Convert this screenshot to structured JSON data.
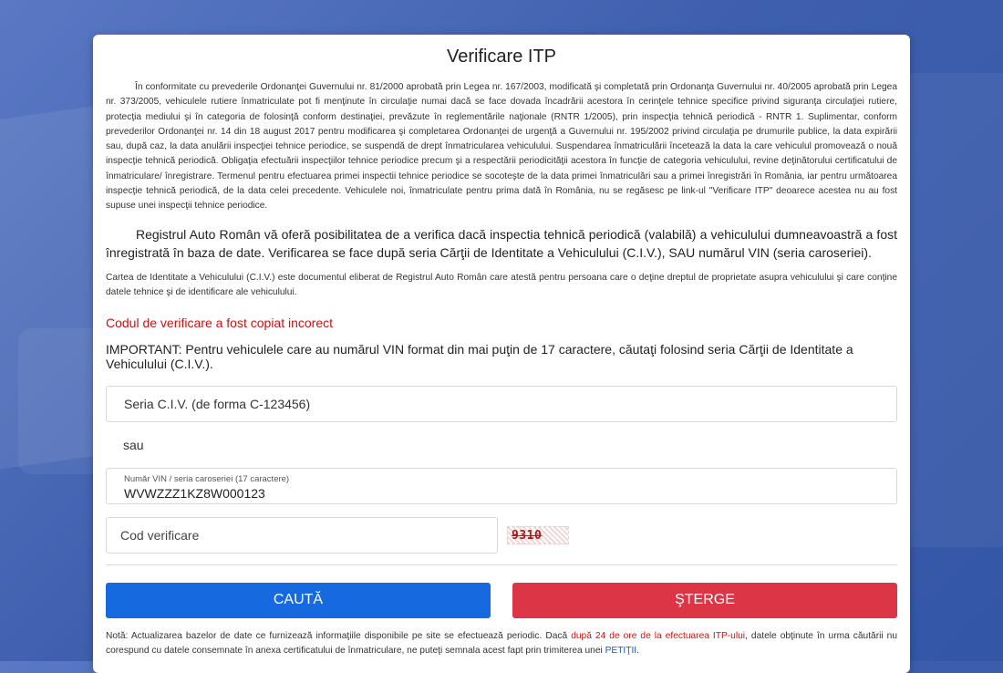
{
  "page": {
    "title": "Verificare ITP"
  },
  "intro": {
    "text": "În conformitate cu prevederile Ordonanţei Guvernului nr. 81/2000 aprobată prin Legea nr. 167/2003, modificată şi completată prin Ordonanţa Guvernului nr. 40/2005 aprobată prin Legea nr. 373/2005, vehiculele rutiere înmatriculate pot fi menţinute în circulaţie numai dacă se face dovada încadrării acestora în cerinţele tehnice specifice privind siguranţa circulaţiei rutiere, protecţia mediului şi în categoria de folosinţă conform destinaţiei, prevăzute în reglementările naţionale (RNTR 1/2005), prin inspecţia tehnică periodică - RNTR 1. Suplimentar, conform prevederilor Ordonanţei nr. 14 din 18 august 2017 pentru modificarea şi completarea Ordonanţei de urgenţă a Guvernului nr. 195/2002 privind circulaţia pe drumurile publice, la data expirării sau, după caz, la data anulării inspecţiei tehnice periodice, se suspendă de drept înmatricularea vehiculului. Suspendarea înmatriculării încetează la data la care vehiculul promovează o nouă inspecţie tehnică periodică. Obligaţia efectuării inspecţiilor tehnice periodice precum şi a respectării periodicităţii acestora în funcţie de categoria vehiculului, revine deţinătorului certificatului de înmatriculare/ înregistrare. Termenul pentru efectuarea primei inspectii tehnice periodice se socoteşte de la data primei înmatriculări sau a primei înregistrări în România, iar pentru următoarea inspecţie tehnică periodică, de la data celei precedente. Vehiculele noi, înmatriculate pentru prima dată în România, nu se regăsesc pe link-ul \"Verificare ITP\" deoarece acestea nu au fost supuse unei inspecţii tehnice periodice."
  },
  "lead": {
    "text": "Registrul Auto Român vă oferă posibilitatea de a verifica dacă inspectia tehnică periodică (valabilă) a vehiculului dumneavoastră a fost înregistrată în baza de date. Verificarea se face după seria Cărţii de Identitate a Vehiculului (C.I.V.), SAU numărul VIN (seria caroseriei)."
  },
  "civ_info": {
    "text": "Cartea de Identitate a Vehiculului (C.I.V.) este documentul eliberat de Registrul Auto Român care atestă pentru persoana care o deţine dreptul de proprietate asupra vehiculului şi care conţine datele tehnice şi de identificare ale vehiculului."
  },
  "error": {
    "text": "Codul de verificare a fost copiat incorect"
  },
  "important": {
    "text": "IMPORTANT: Pentru vehiculele care au numărul VIN format din mai puţin de 17 caractere, căutaţi folosind seria Cărţii de Identitate a Vehiculului (C.I.V.)."
  },
  "form": {
    "civ_placeholder": "Seria C.I.V. (de forma C-123456)",
    "or_label": "sau",
    "vin_label": "Număr VIN / seria caroseriei (17 caractere)",
    "vin_value": "WVWZZZ1KZ8W000123",
    "code_placeholder": "Cod verificare",
    "captcha_text": "9310"
  },
  "buttons": {
    "search_label": "CAUTĂ",
    "clear_label": "ŞTERGE"
  },
  "note": {
    "prefix": "Notă: Actualizarea bazelor de date ce furnizează informaţiile disponibile pe site se efectuează periodic. Dacă ",
    "highlight": "după 24 de ore de la efectuarea ITP-ului",
    "middle": ", datele obţinute în urma căutării nu corespund cu datele consemnate în anexa certificatului de înmatriculare, ne puteţi semnala acest fapt prin trimiterea unei ",
    "link": "PETIŢII",
    "suffix": "."
  },
  "colors": {
    "search_button": "#1769e0",
    "clear_button": "#dc3545",
    "error_text": "#cc1111",
    "link": "#1a56c8"
  }
}
